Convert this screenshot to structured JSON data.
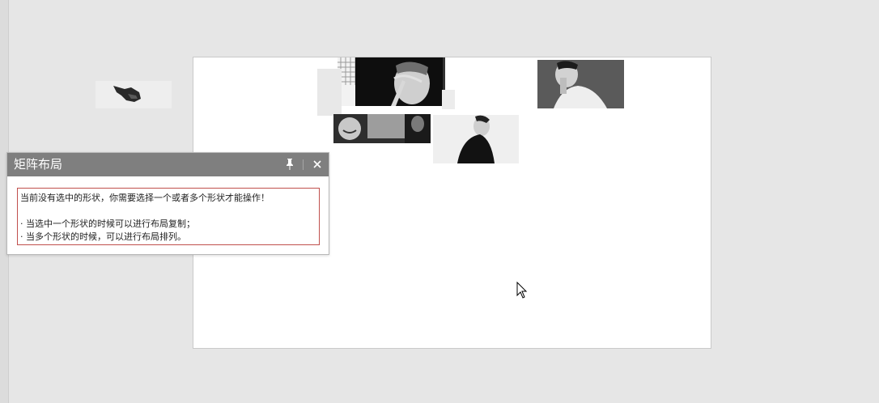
{
  "panel": {
    "title": "矩阵布局",
    "pin_icon": "pin-icon",
    "close_icon": "close-icon",
    "message": {
      "line1": "当前没有选中的形状，你需要选择一个或者多个形状才能操作！",
      "line2": "· 当选中一个形状的时候可以进行布局复制；",
      "line3": "· 当多个形状的时候，可以进行布局排列。"
    },
    "accent_border": "#c0504d",
    "header_bg": "#7f7f7f"
  },
  "canvas": {
    "background": "#e6e6e6",
    "slide_background": "#ffffff"
  },
  "images": [
    {
      "name": "photo-grid-window"
    },
    {
      "name": "photo-man-with-stick"
    },
    {
      "name": "photo-man-hand-on-face"
    },
    {
      "name": "photo-laughing-group"
    },
    {
      "name": "photo-man-profile-black"
    },
    {
      "name": "photo-hand-pointing"
    }
  ],
  "cursor_icon": "mouse-pointer-icon"
}
